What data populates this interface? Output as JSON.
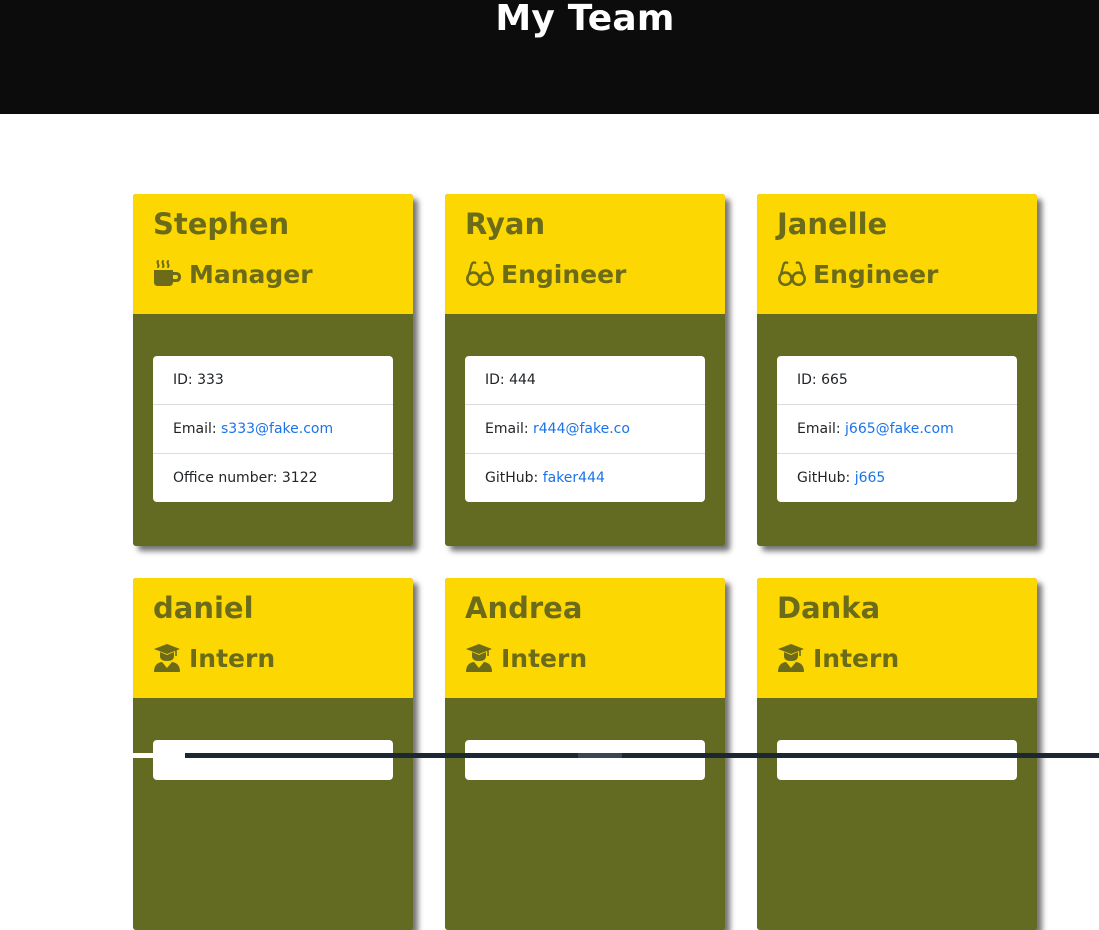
{
  "header": {
    "title": "My Team"
  },
  "colors": {
    "card_head": "#fdd701",
    "card_body": "#636a21",
    "title_text": "#6b6b1a",
    "link": "#1a73e8",
    "header_bg": "#0c0c0c"
  },
  "cards": [
    {
      "name": "Stephen",
      "role": "Manager",
      "icon": "coffee-icon",
      "id_label": "ID: ",
      "id": "333",
      "email_label": "Email: ",
      "email": "s333@fake.com",
      "extra_label": "Office number: ",
      "extra": "3122"
    },
    {
      "name": "Ryan",
      "role": "Engineer",
      "icon": "glasses-icon",
      "id_label": "ID: ",
      "id": "444",
      "email_label": "Email: ",
      "email": "r444@fake.co",
      "extra_label": "GitHub: ",
      "extra": "faker444"
    },
    {
      "name": "Janelle",
      "role": "Engineer",
      "icon": "glasses-icon",
      "id_label": "ID: ",
      "id": "665",
      "email_label": "Email: ",
      "email": "j665@fake.com",
      "extra_label": "GitHub: ",
      "extra": "j665"
    },
    {
      "name": "daniel",
      "role": "Intern",
      "icon": "graduate-icon"
    },
    {
      "name": "Andrea",
      "role": "Intern",
      "icon": "graduate-icon"
    },
    {
      "name": "Danka",
      "role": "Intern",
      "icon": "graduate-icon"
    }
  ]
}
